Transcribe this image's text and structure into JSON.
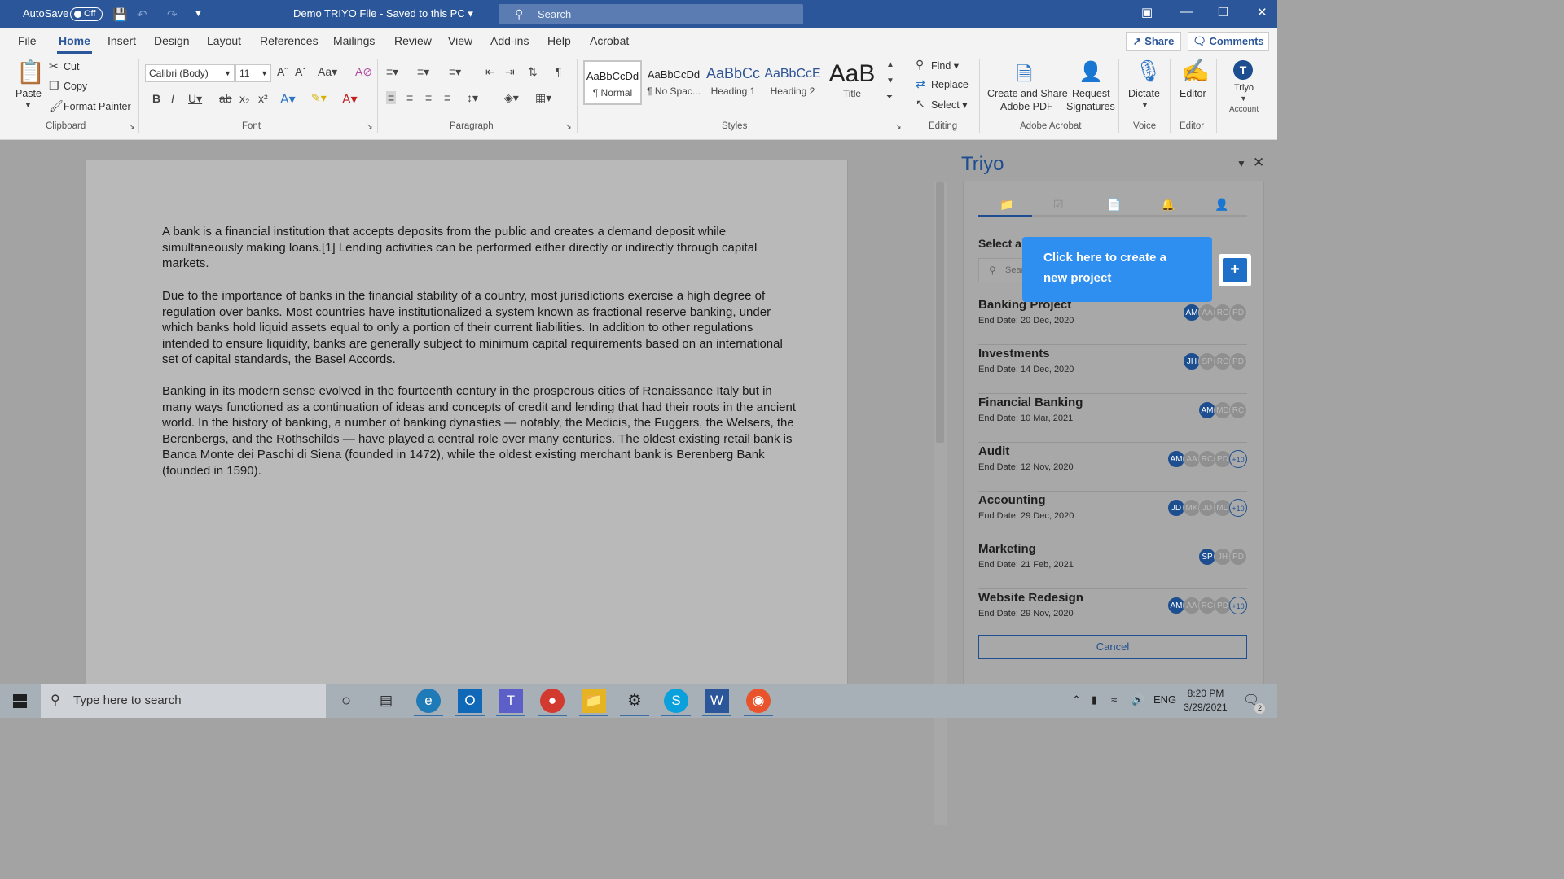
{
  "titlebar": {
    "autosave_label": "AutoSave",
    "autosave_state": "Off",
    "doc_title": "Demo TRIYO File - Saved to this PC",
    "search_placeholder": "Search"
  },
  "tabs": [
    "File",
    "Home",
    "Insert",
    "Design",
    "Layout",
    "References",
    "Mailings",
    "Review",
    "View",
    "Add-ins",
    "Help",
    "Acrobat"
  ],
  "active_tab": "Home",
  "share_label": "Share",
  "comments_label": "Comments",
  "ribbon": {
    "clipboard": {
      "paste": "Paste",
      "cut": "Cut",
      "copy": "Copy",
      "format_painter": "Format Painter",
      "group": "Clipboard"
    },
    "font": {
      "font_name": "Calibri (Body)",
      "font_size": "11",
      "group": "Font"
    },
    "paragraph": {
      "group": "Paragraph"
    },
    "styles": {
      "items": [
        {
          "sample": "AaBbCcDd",
          "name": "¶ Normal"
        },
        {
          "sample": "AaBbCcDd",
          "name": "¶ No Spac..."
        },
        {
          "sample": "AaBbCc",
          "name": "Heading 1"
        },
        {
          "sample": "AaBbCcE",
          "name": "Heading 2"
        },
        {
          "sample": "AaB",
          "name": "Title"
        }
      ],
      "group": "Styles"
    },
    "editing": {
      "find": "Find",
      "replace": "Replace",
      "select": "Select",
      "group": "Editing"
    },
    "acrobat": {
      "create_share": "Create and Share",
      "adobe_pdf": "Adobe PDF",
      "request": "Request",
      "signatures": "Signatures",
      "group": "Adobe Acrobat"
    },
    "voice": {
      "dictate": "Dictate",
      "group": "Voice"
    },
    "editor": {
      "editor": "Editor",
      "group": "Editor"
    },
    "triyo": {
      "label": "Triyo",
      "account": "Account"
    }
  },
  "document": {
    "paragraphs": [
      "A bank is a financial institution that accepts deposits from the public and creates a demand deposit while simultaneously making loans.[1] Lending activities can be performed either directly or indirectly through capital markets.",
      "Due to the importance of banks in the financial stability of a country, most jurisdictions exercise a high degree of regulation over banks. Most countries have institutionalized a system known as fractional reserve banking, under which banks hold liquid assets equal to only a portion of their current liabilities. In addition to other regulations intended to ensure liquidity, banks are generally subject to minimum capital requirements based on an international set of capital standards, the Basel Accords.",
      "Banking in its modern sense evolved in the fourteenth century in the prosperous cities of Renaissance Italy but in many ways functioned as a continuation of ideas and concepts of credit and lending that had their roots in the ancient world. In the history of banking, a number of banking dynasties — notably, the Medicis, the Fuggers, the Welsers, the Berenbergs, and the Rothschilds — have played a central role over many centuries. The oldest existing retail bank is Banca Monte dei Paschi di Siena (founded in 1472), while the oldest existing merchant bank is Berenberg Bank (founded in 1590)."
    ]
  },
  "triyo_pane": {
    "title": "Triyo",
    "select_label": "Select a Project",
    "search_placeholder": "Search",
    "projects": [
      {
        "name": "Banking Project",
        "end_date": "End Date: 20 Dec, 2020",
        "avatars": [
          "AM",
          "AA",
          "RC",
          "PD"
        ],
        "more": ""
      },
      {
        "name": "Investments",
        "end_date": "End Date: 14 Dec, 2020",
        "avatars": [
          "JH",
          "SP",
          "RC",
          "PD"
        ],
        "more": ""
      },
      {
        "name": "Financial Banking",
        "end_date": "End Date: 10 Mar, 2021",
        "avatars": [
          "AM",
          "MD",
          "RC"
        ],
        "more": ""
      },
      {
        "name": "Audit",
        "end_date": "End Date: 12 Nov, 2020",
        "avatars": [
          "AM",
          "AA",
          "RC",
          "PD"
        ],
        "more": "+10"
      },
      {
        "name": "Accounting",
        "end_date": "End Date: 29 Dec, 2020",
        "avatars": [
          "JD",
          "MK",
          "JD",
          "MD"
        ],
        "more": "+10"
      },
      {
        "name": "Marketing",
        "end_date": "End Date: 21 Feb, 2021",
        "avatars": [
          "SP",
          "JH",
          "PD"
        ],
        "more": ""
      },
      {
        "name": "Website Redesign",
        "end_date": "End Date: 29 Nov, 2020",
        "avatars": [
          "AM",
          "AA",
          "RC",
          "PD"
        ],
        "more": "+10"
      }
    ],
    "cancel_label": "Cancel",
    "tooltip": "Click here to create a new project",
    "plus_label": "+"
  },
  "taskbar": {
    "search_placeholder": "Type here to search",
    "language": "ENG",
    "time": "8:20 PM",
    "date": "3/29/2021",
    "notification_count": "2"
  }
}
